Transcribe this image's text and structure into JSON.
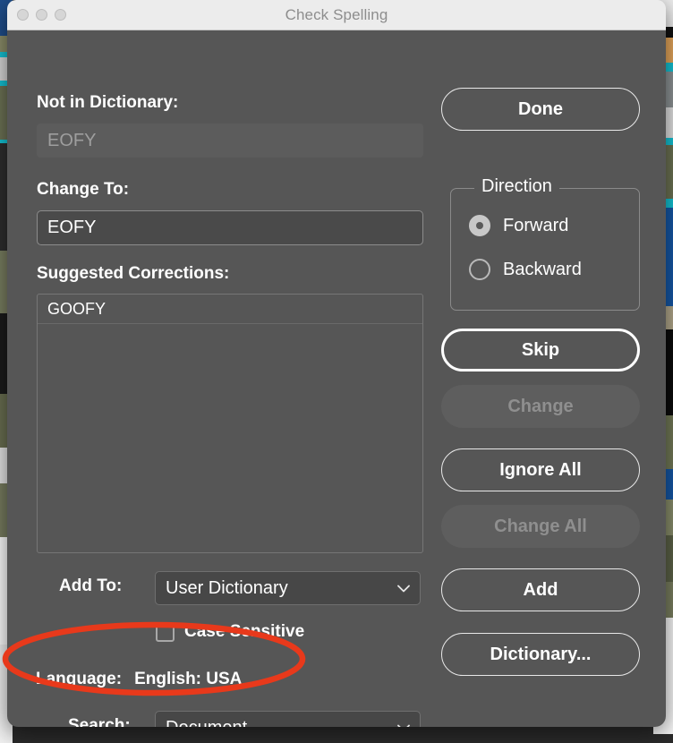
{
  "window": {
    "title": "Check Spelling",
    "traffic_lights": [
      "close-button",
      "minimize-button",
      "zoom-button"
    ]
  },
  "fields": {
    "not_in_dictionary_label": "Not in Dictionary:",
    "not_in_dictionary_value": "EOFY",
    "change_to_label": "Change To:",
    "change_to_value": "EOFY",
    "suggested_label": "Suggested Corrections:",
    "suggestions": [
      "GOOFY"
    ]
  },
  "direction": {
    "group_label": "Direction",
    "options": [
      {
        "label": "Forward",
        "selected": true
      },
      {
        "label": "Backward",
        "selected": false
      }
    ]
  },
  "buttons": {
    "done": "Done",
    "skip": "Skip",
    "change": "Change",
    "ignore_all": "Ignore All",
    "change_all": "Change All",
    "add": "Add",
    "dictionary": "Dictionary..."
  },
  "options": {
    "add_to_label": "Add To:",
    "add_to_value": "User Dictionary",
    "case_sensitive_label": "Case Sensitive",
    "case_sensitive_checked": false,
    "language_label": "Language:",
    "language_value": "English: USA",
    "search_label": "Search:",
    "search_value": "Document"
  },
  "annotation": {
    "shape": "ellipse",
    "color": "#e8391b",
    "target": "Language: English: USA"
  },
  "colors": {
    "dialog_background": "#565656",
    "titlebar": "#ececec",
    "title_text": "#8d8d8d",
    "field_dark": "#474747",
    "accent_annotation": "#e8391b"
  }
}
